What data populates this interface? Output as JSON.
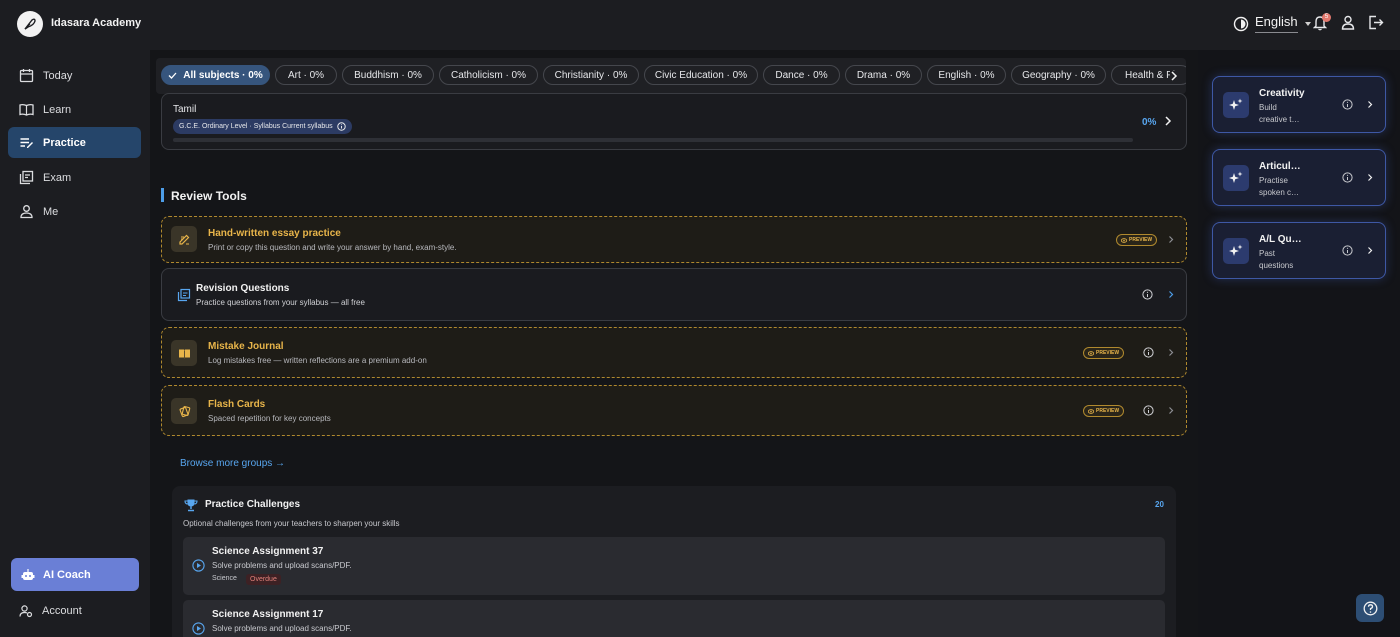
{
  "app": {
    "title": "Idasara Academy"
  },
  "header": {
    "language": "English",
    "notification_count": "5"
  },
  "sidebar": {
    "items": [
      {
        "label": "Today",
        "icon": "calendar-icon"
      },
      {
        "label": "Learn",
        "icon": "book-icon"
      },
      {
        "label": "Practice",
        "icon": "practice-icon",
        "active": true
      },
      {
        "label": "Exam",
        "icon": "exam-icon"
      },
      {
        "label": "Me",
        "icon": "person-icon"
      }
    ],
    "ai_coach": "AI Coach",
    "account": "Account"
  },
  "subjects": [
    "All subjects · 0%",
    "Art · 0%",
    "Buddhism · 0%",
    "Catholicism · 0%",
    "Christianity · 0%",
    "Civic Education · 0%",
    "Dance · 0%",
    "Drama · 0%",
    "English · 0%",
    "Geography · 0%",
    "Health & Ph"
  ],
  "current_subject": {
    "name": "Tamil",
    "syllabus": "G.C.E. Ordinary Level · Syllabus Current syllabus",
    "percent": "0%",
    "progress": 0
  },
  "review_tools": {
    "title": "Review Tools",
    "preview_label": "PREVIEW",
    "items": [
      {
        "title": "Hand-written essay practice",
        "desc": "Print or copy this question and write your answer by hand, exam-style.",
        "preview": true,
        "icon": "pencil-icon"
      },
      {
        "title": "Revision Questions",
        "desc": "Practice questions from your syllabus — all free",
        "preview": false,
        "icon": "quiz-icon"
      },
      {
        "title": "Mistake Journal",
        "desc": "Log mistakes free — written reflections are a premium add-on",
        "preview": true,
        "icon": "journal-icon"
      },
      {
        "title": "Flash Cards",
        "desc": "Spaced repetition for key concepts",
        "preview": true,
        "icon": "cards-icon"
      }
    ]
  },
  "browse_more": "Browse more groups →",
  "challenges": {
    "title": "Practice Challenges",
    "count": "20",
    "subtitle": "Optional challenges from your teachers to sharpen your skills",
    "items": [
      {
        "title": "Science Assignment 37",
        "desc": "Solve problems and upload scans/PDF.",
        "subject": "Science",
        "status": "Overdue"
      },
      {
        "title": "Science Assignment 17",
        "desc": "Solve problems and upload scans/PDF."
      }
    ]
  },
  "right_cards": [
    {
      "title": "Creativity",
      "line1": "Build",
      "line2": "creative thinking"
    },
    {
      "title": "Articulation",
      "line1": "Practise",
      "line2": "spoken communication"
    },
    {
      "title": "A/L Questions",
      "line1": "Past",
      "line2": "questions"
    }
  ],
  "colors": {
    "accent": "#4d9de8",
    "preview_gold": "#e8b54a",
    "active_nav": "#25456a",
    "ai_coach": "#6a7fd6"
  }
}
